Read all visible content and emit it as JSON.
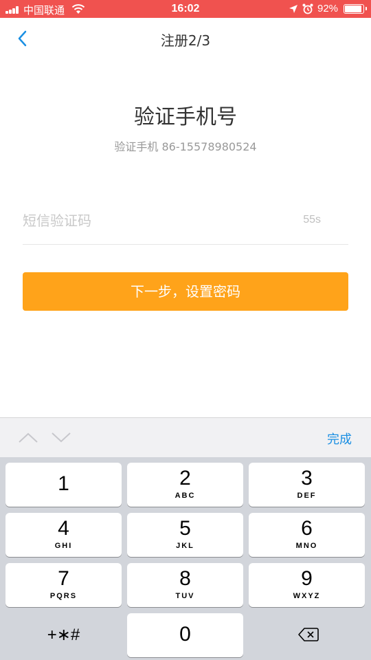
{
  "status_bar": {
    "carrier": "中国联通",
    "time": "16:02",
    "battery": "92%",
    "battery_level": 0.92
  },
  "nav": {
    "title": "注册2/3",
    "back_icon": "chevron-left-icon"
  },
  "main": {
    "heading": "验证手机号",
    "subheading": "验证手机 86-15578980524",
    "code_placeholder": "短信验证码",
    "code_value": "",
    "countdown": "55s",
    "next_button": "下一步，设置密码"
  },
  "colors": {
    "status_bar": "#f0524f",
    "accent_button": "#ffa31a",
    "link_blue": "#1a8fe3"
  },
  "keyboard": {
    "done_label": "完成",
    "keys": [
      {
        "num": "1",
        "letters": ""
      },
      {
        "num": "2",
        "letters": "ABC"
      },
      {
        "num": "3",
        "letters": "DEF"
      },
      {
        "num": "4",
        "letters": "GHI"
      },
      {
        "num": "5",
        "letters": "JKL"
      },
      {
        "num": "6",
        "letters": "MNO"
      },
      {
        "num": "7",
        "letters": "PQRS"
      },
      {
        "num": "8",
        "letters": "TUV"
      },
      {
        "num": "9",
        "letters": "WXYZ"
      },
      {
        "num": "0",
        "letters": ""
      }
    ],
    "symbols_label": "+∗#"
  }
}
